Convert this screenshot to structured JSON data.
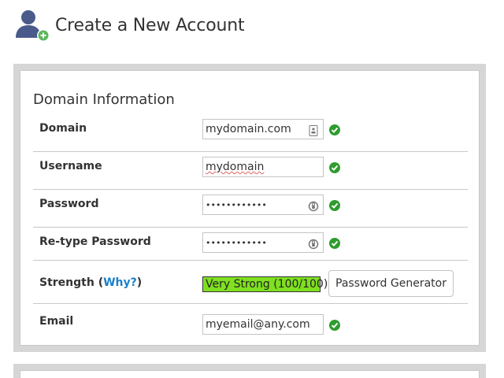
{
  "header": {
    "title": "Create a New Account",
    "icon": "user-add-icon"
  },
  "section": {
    "title": "Domain Information"
  },
  "fields": {
    "domain": {
      "label": "Domain",
      "value": "mydomain.com",
      "icon": "contact-card-icon",
      "status": "valid"
    },
    "username": {
      "label": "Username",
      "value": "mydomain",
      "status": "valid"
    },
    "password": {
      "label": "Password",
      "value": "••••••••••••",
      "icon": "password-reveal-icon",
      "status": "valid"
    },
    "retype_password": {
      "label": "Re-type Password",
      "value": "••••••••••••",
      "icon": "password-reveal-icon",
      "status": "valid"
    },
    "strength": {
      "label_prefix": "Strength (",
      "link": "Why?",
      "label_suffix": ")",
      "meter_text": "Very Strong (100/100)",
      "score": 100,
      "meter_color": "#7fe01f"
    },
    "email": {
      "label": "Email",
      "value": "myemail@any.com",
      "status": "valid"
    }
  },
  "buttons": {
    "password_generator": "Password Generator"
  },
  "colors": {
    "accent_link": "#1a7fc7",
    "valid_green": "#2e9c2e",
    "panel_border": "#d6d6d6"
  }
}
